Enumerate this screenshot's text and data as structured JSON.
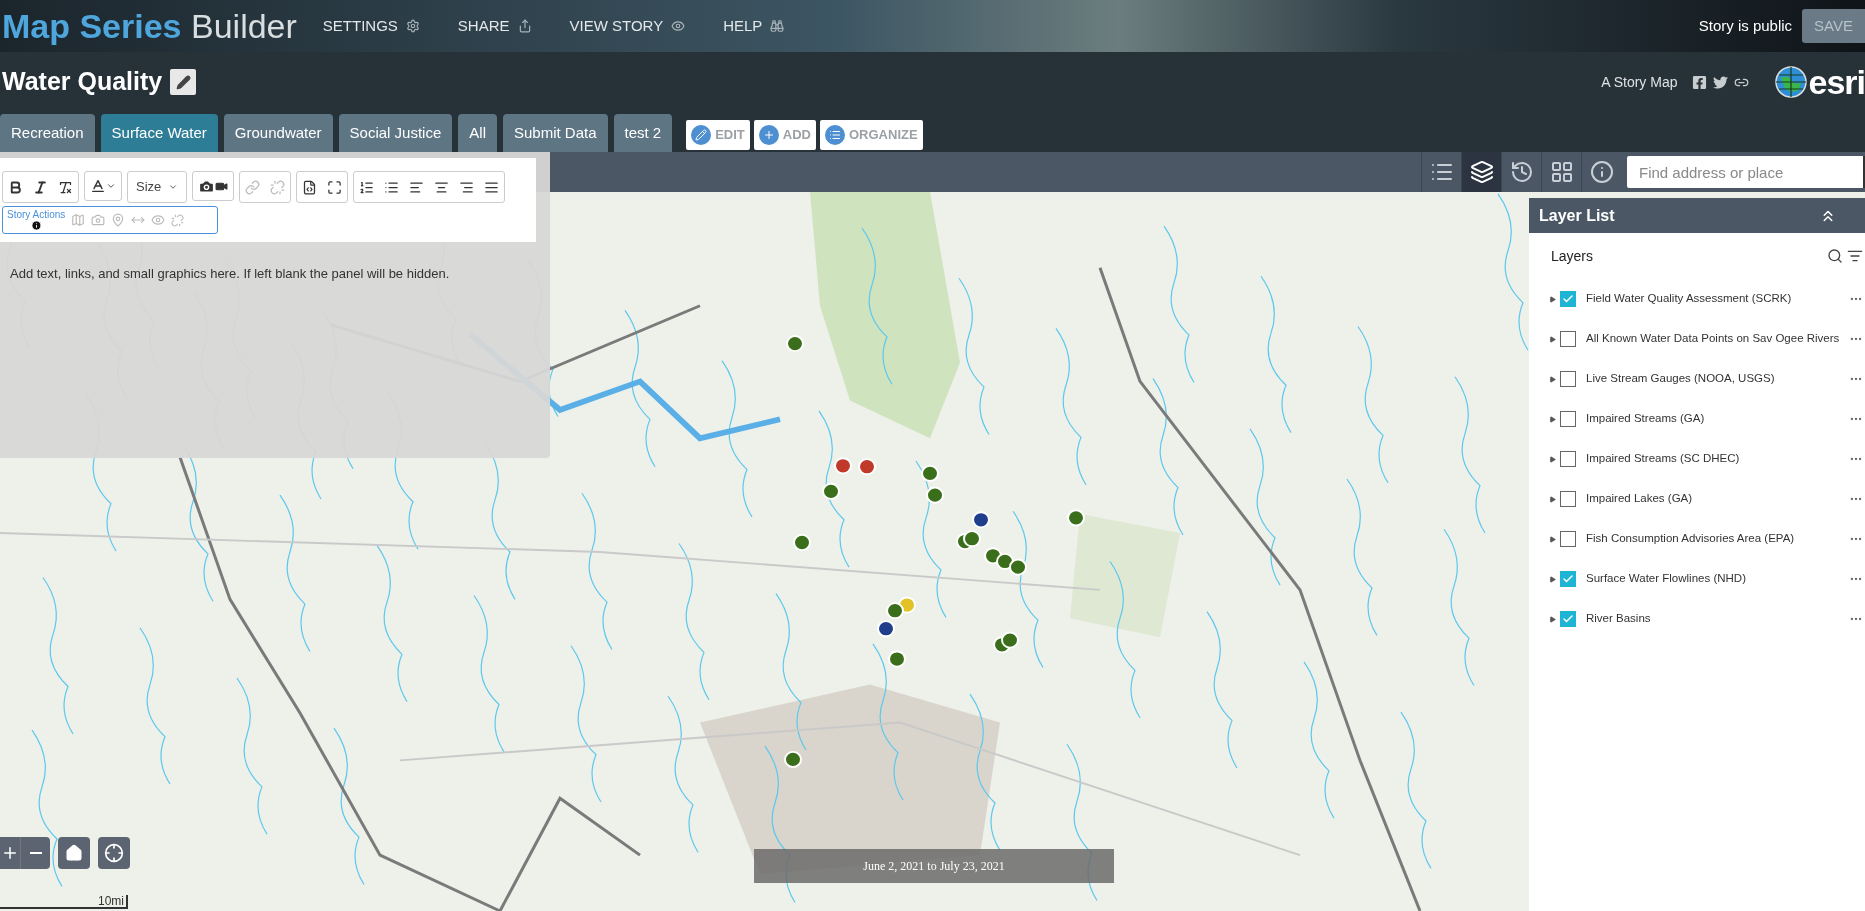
{
  "header": {
    "brand_strong": "Map Series",
    "brand_light": "Builder",
    "nav": [
      {
        "label": "SETTINGS",
        "kind": "settings"
      },
      {
        "label": "SHARE",
        "kind": "share"
      },
      {
        "label": "VIEW STORY",
        "kind": "view"
      },
      {
        "label": "HELP",
        "kind": "help"
      }
    ],
    "status": "Story is public",
    "save": "SAVE"
  },
  "title_bar": {
    "title": "Water Quality",
    "byline": "A Story Map",
    "logo": "esri"
  },
  "tabs": [
    {
      "label": "Recreation",
      "selected": false
    },
    {
      "label": "Surface Water",
      "selected": true
    },
    {
      "label": "Groundwater",
      "selected": false
    },
    {
      "label": "Social Justice",
      "selected": false
    },
    {
      "label": "All",
      "selected": false
    },
    {
      "label": "Submit Data",
      "selected": false
    },
    {
      "label": "test 2",
      "selected": false
    }
  ],
  "tab_actions": [
    {
      "label": "EDIT",
      "kind": "edit"
    },
    {
      "label": "ADD",
      "kind": "add"
    },
    {
      "label": "ORGANIZE",
      "kind": "organize"
    }
  ],
  "editor": {
    "size_label": "Size",
    "story_actions": "Story Actions",
    "placeholder": "Add text, links, and small graphics here. If left blank the panel will be hidden."
  },
  "map_tools": [
    {
      "kind": "legend",
      "selected": false
    },
    {
      "kind": "layers",
      "selected": true
    },
    {
      "kind": "history",
      "selected": false
    },
    {
      "kind": "basemap",
      "selected": false
    },
    {
      "kind": "info",
      "selected": false
    }
  ],
  "search": {
    "placeholder": "Find address or place"
  },
  "layer_list": {
    "title": "Layer List",
    "heading": "Layers",
    "layers": [
      {
        "name": "Field Water Quality Assessment (SCRK)",
        "checked": true
      },
      {
        "name": "All Known Water Data Points on Sav Ogee Rivers",
        "checked": false
      },
      {
        "name": "Live Stream Gauges (NOOA, USGS)",
        "checked": false
      },
      {
        "name": "Impaired Streams (GA)",
        "checked": false
      },
      {
        "name": "Impaired Streams (SC DHEC)",
        "checked": false
      },
      {
        "name": "Impaired Lakes (GA)",
        "checked": false
      },
      {
        "name": "Fish Consumption Advisories Area (EPA)",
        "checked": false
      },
      {
        "name": "Surface Water Flowlines (NHD)",
        "checked": true
      },
      {
        "name": "River Basins",
        "checked": true
      }
    ]
  },
  "time_extent": "June 2, 2021 to July 23, 2021",
  "scale": "10mi"
}
